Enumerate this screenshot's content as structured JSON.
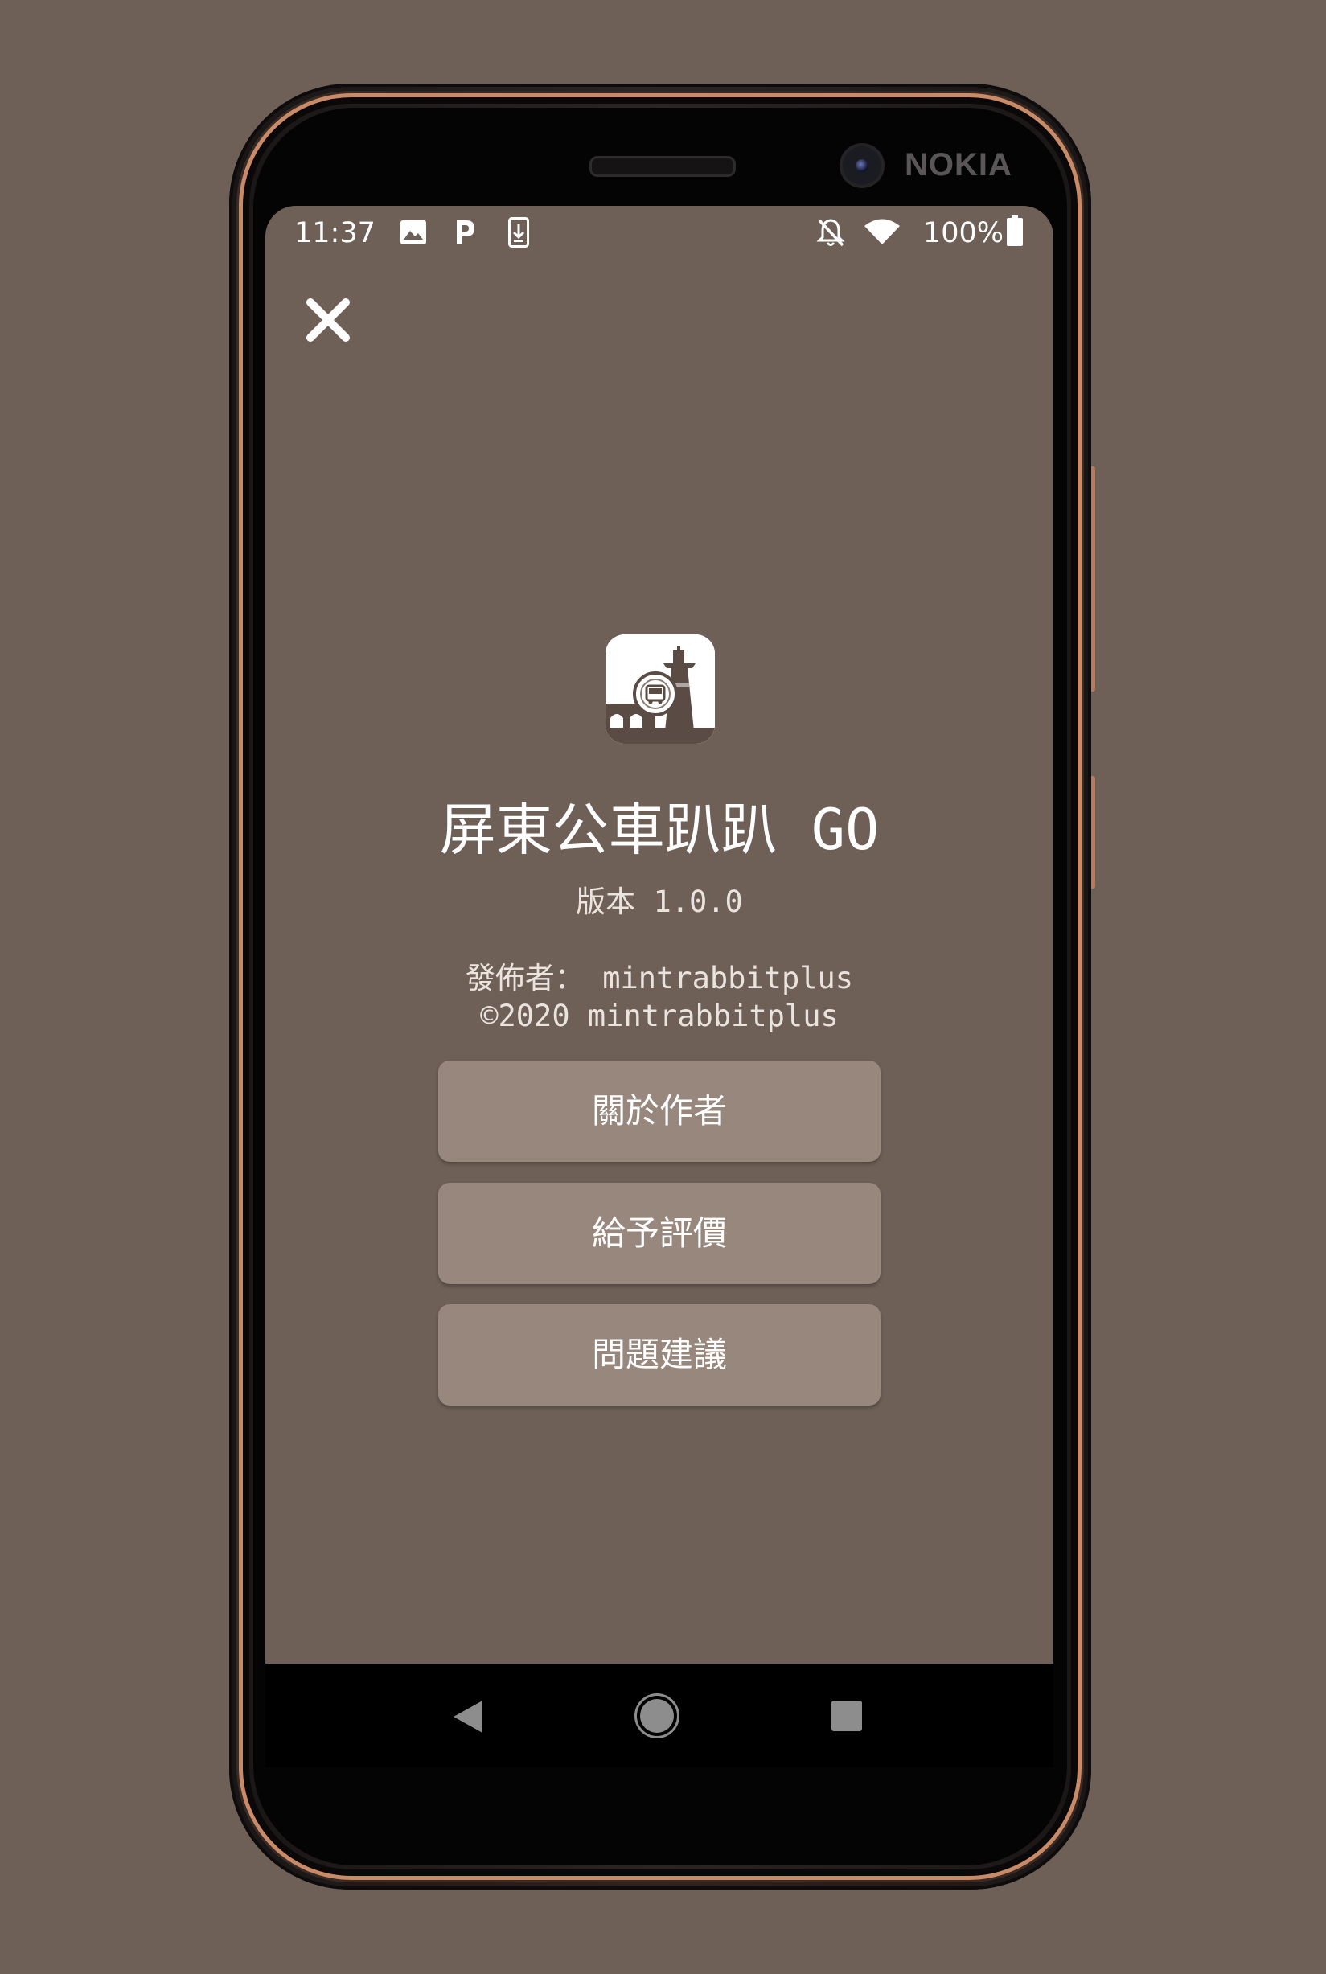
{
  "status_bar": {
    "time": "11:37",
    "battery": "100%",
    "icons": [
      "image-icon",
      "parking-app-icon",
      "download-icon",
      "notifications-off-icon",
      "wifi-icon",
      "battery-full-icon"
    ]
  },
  "device": {
    "brand": "NOKIA"
  },
  "about": {
    "app_name": "屏東公車趴趴 GO",
    "version": "版本 1.0.0",
    "publisher": "發佈者： mintrabbitplus",
    "copyright": "©2020 mintrabbitplus"
  },
  "buttons": {
    "about_author": "關於作者",
    "rate": "給予評價",
    "feedback": "問題建議"
  },
  "colors": {
    "background": "#6e6057",
    "button": "#97877d",
    "text": "#ffffff"
  }
}
